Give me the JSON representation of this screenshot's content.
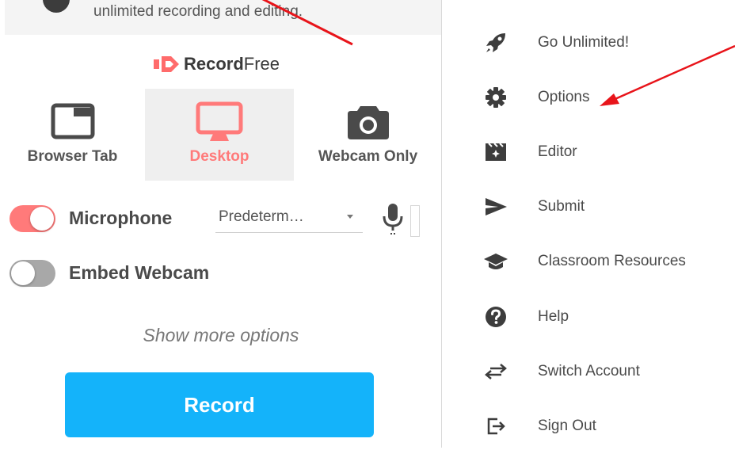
{
  "banner": {
    "text": "unlimited recording and editing."
  },
  "logo": {
    "bold": "Record",
    "light": "Free"
  },
  "modes": [
    {
      "label": "Browser Tab",
      "icon": "browser-tab-icon",
      "selected": false
    },
    {
      "label": "Desktop",
      "icon": "desktop-monitor-icon",
      "selected": true
    },
    {
      "label": "Webcam Only",
      "icon": "camera-icon",
      "selected": false
    }
  ],
  "microphone": {
    "label": "Microphone",
    "enabled": true,
    "device": "Predeterm…"
  },
  "webcam": {
    "label": "Embed Webcam",
    "enabled": false
  },
  "more_options": "Show more options",
  "record_button": "Record",
  "menu": [
    {
      "label": "Go Unlimited!",
      "icon": "rocket-icon"
    },
    {
      "label": "Options",
      "icon": "gear-icon"
    },
    {
      "label": "Editor",
      "icon": "film-editor-icon"
    },
    {
      "label": "Submit",
      "icon": "send-icon"
    },
    {
      "label": "Classroom Resources",
      "icon": "graduation-cap-icon"
    },
    {
      "label": "Help",
      "icon": "help-circle-icon"
    },
    {
      "label": "Switch Account",
      "icon": "switch-arrows-icon"
    },
    {
      "label": "Sign Out",
      "icon": "sign-out-icon"
    }
  ],
  "colors": {
    "accent": "#ff7a7a",
    "record": "#14b3fa",
    "annotation_arrow": "#e8141a"
  }
}
